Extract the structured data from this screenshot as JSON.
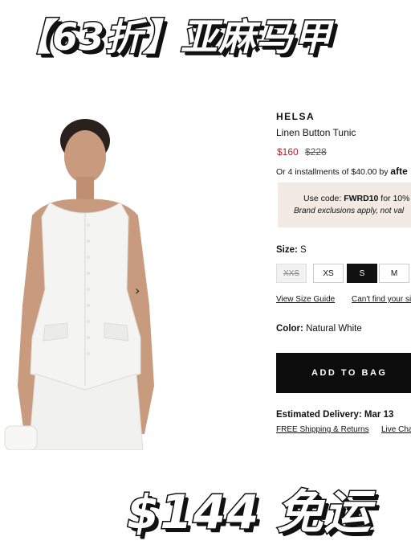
{
  "overlay": {
    "top_title": "【63折】亚麻马甲",
    "bottom_title": "$144 免运"
  },
  "product": {
    "brand": "HELSA",
    "name": "Linen Button Tunic",
    "price_sale": "$160",
    "price_original": "$228",
    "installments_text": "Or 4 installments of $40.00 by",
    "installments_logo": "afte",
    "image_next": "›"
  },
  "promo": {
    "line1_prefix": "Use code:",
    "code": "FWRD10",
    "line1_suffix": "for 10%",
    "line2": "Brand exclusions apply, not val"
  },
  "size": {
    "label": "Size:",
    "selected_value": "S",
    "options": [
      "XXS",
      "XS",
      "S",
      "M"
    ],
    "view_size_guide": "View Size Guide",
    "find_size": "Can't find your si"
  },
  "color": {
    "label": "Color:",
    "value": "Natural White"
  },
  "actions": {
    "add_to_bag": "ADD TO BAG"
  },
  "delivery": {
    "estimated": "Estimated Delivery: Mar 13",
    "free_shipping": "FREE Shipping & Returns",
    "live_chat": "Live Cha"
  },
  "colors": {
    "sale_price": "#b3232e",
    "promo_bg": "#f3eae3",
    "button_bg": "#0c0c0c"
  }
}
